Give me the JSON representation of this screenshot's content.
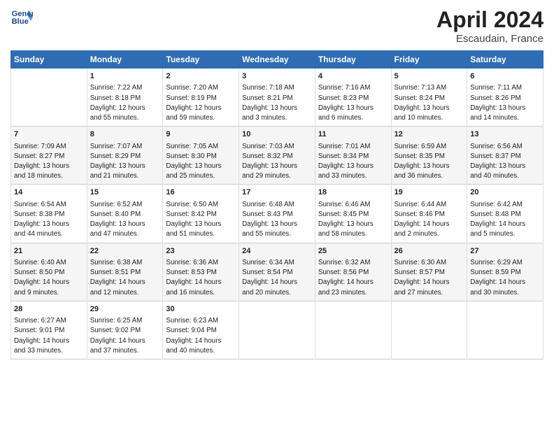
{
  "header": {
    "logo_line1": "General",
    "logo_line2": "Blue",
    "title": "April 2024",
    "subtitle": "Escaudain, France"
  },
  "columns": [
    "Sunday",
    "Monday",
    "Tuesday",
    "Wednesday",
    "Thursday",
    "Friday",
    "Saturday"
  ],
  "weeks": [
    {
      "cells": [
        {
          "day": "",
          "data": ""
        },
        {
          "day": "1",
          "data": "Sunrise: 7:22 AM\nSunset: 8:18 PM\nDaylight: 12 hours\nand 55 minutes."
        },
        {
          "day": "2",
          "data": "Sunrise: 7:20 AM\nSunset: 8:19 PM\nDaylight: 12 hours\nand 59 minutes."
        },
        {
          "day": "3",
          "data": "Sunrise: 7:18 AM\nSunset: 8:21 PM\nDaylight: 13 hours\nand 3 minutes."
        },
        {
          "day": "4",
          "data": "Sunrise: 7:16 AM\nSunset: 8:23 PM\nDaylight: 13 hours\nand 6 minutes."
        },
        {
          "day": "5",
          "data": "Sunrise: 7:13 AM\nSunset: 8:24 PM\nDaylight: 13 hours\nand 10 minutes."
        },
        {
          "day": "6",
          "data": "Sunrise: 7:11 AM\nSunset: 8:26 PM\nDaylight: 13 hours\nand 14 minutes."
        }
      ]
    },
    {
      "cells": [
        {
          "day": "7",
          "data": "Sunrise: 7:09 AM\nSunset: 8:27 PM\nDaylight: 13 hours\nand 18 minutes."
        },
        {
          "day": "8",
          "data": "Sunrise: 7:07 AM\nSunset: 8:29 PM\nDaylight: 13 hours\nand 21 minutes."
        },
        {
          "day": "9",
          "data": "Sunrise: 7:05 AM\nSunset: 8:30 PM\nDaylight: 13 hours\nand 25 minutes."
        },
        {
          "day": "10",
          "data": "Sunrise: 7:03 AM\nSunset: 8:32 PM\nDaylight: 13 hours\nand 29 minutes."
        },
        {
          "day": "11",
          "data": "Sunrise: 7:01 AM\nSunset: 8:34 PM\nDaylight: 13 hours\nand 33 minutes."
        },
        {
          "day": "12",
          "data": "Sunrise: 6:59 AM\nSunset: 8:35 PM\nDaylight: 13 hours\nand 36 minutes."
        },
        {
          "day": "13",
          "data": "Sunrise: 6:56 AM\nSunset: 8:37 PM\nDaylight: 13 hours\nand 40 minutes."
        }
      ]
    },
    {
      "cells": [
        {
          "day": "14",
          "data": "Sunrise: 6:54 AM\nSunset: 8:38 PM\nDaylight: 13 hours\nand 44 minutes."
        },
        {
          "day": "15",
          "data": "Sunrise: 6:52 AM\nSunset: 8:40 PM\nDaylight: 13 hours\nand 47 minutes."
        },
        {
          "day": "16",
          "data": "Sunrise: 6:50 AM\nSunset: 8:42 PM\nDaylight: 13 hours\nand 51 minutes."
        },
        {
          "day": "17",
          "data": "Sunrise: 6:48 AM\nSunset: 8:43 PM\nDaylight: 13 hours\nand 55 minutes."
        },
        {
          "day": "18",
          "data": "Sunrise: 6:46 AM\nSunset: 8:45 PM\nDaylight: 13 hours\nand 58 minutes."
        },
        {
          "day": "19",
          "data": "Sunrise: 6:44 AM\nSunset: 8:46 PM\nDaylight: 14 hours\nand 2 minutes."
        },
        {
          "day": "20",
          "data": "Sunrise: 6:42 AM\nSunset: 8:48 PM\nDaylight: 14 hours\nand 5 minutes."
        }
      ]
    },
    {
      "cells": [
        {
          "day": "21",
          "data": "Sunrise: 6:40 AM\nSunset: 8:50 PM\nDaylight: 14 hours\nand 9 minutes."
        },
        {
          "day": "22",
          "data": "Sunrise: 6:38 AM\nSunset: 8:51 PM\nDaylight: 14 hours\nand 12 minutes."
        },
        {
          "day": "23",
          "data": "Sunrise: 6:36 AM\nSunset: 8:53 PM\nDaylight: 14 hours\nand 16 minutes."
        },
        {
          "day": "24",
          "data": "Sunrise: 6:34 AM\nSunset: 8:54 PM\nDaylight: 14 hours\nand 20 minutes."
        },
        {
          "day": "25",
          "data": "Sunrise: 6:32 AM\nSunset: 8:56 PM\nDaylight: 14 hours\nand 23 minutes."
        },
        {
          "day": "26",
          "data": "Sunrise: 6:30 AM\nSunset: 8:57 PM\nDaylight: 14 hours\nand 27 minutes."
        },
        {
          "day": "27",
          "data": "Sunrise: 6:29 AM\nSunset: 8:59 PM\nDaylight: 14 hours\nand 30 minutes."
        }
      ]
    },
    {
      "cells": [
        {
          "day": "28",
          "data": "Sunrise: 6:27 AM\nSunset: 9:01 PM\nDaylight: 14 hours\nand 33 minutes."
        },
        {
          "day": "29",
          "data": "Sunrise: 6:25 AM\nSunset: 9:02 PM\nDaylight: 14 hours\nand 37 minutes."
        },
        {
          "day": "30",
          "data": "Sunrise: 6:23 AM\nSunset: 9:04 PM\nDaylight: 14 hours\nand 40 minutes."
        },
        {
          "day": "",
          "data": ""
        },
        {
          "day": "",
          "data": ""
        },
        {
          "day": "",
          "data": ""
        },
        {
          "day": "",
          "data": ""
        }
      ]
    }
  ]
}
